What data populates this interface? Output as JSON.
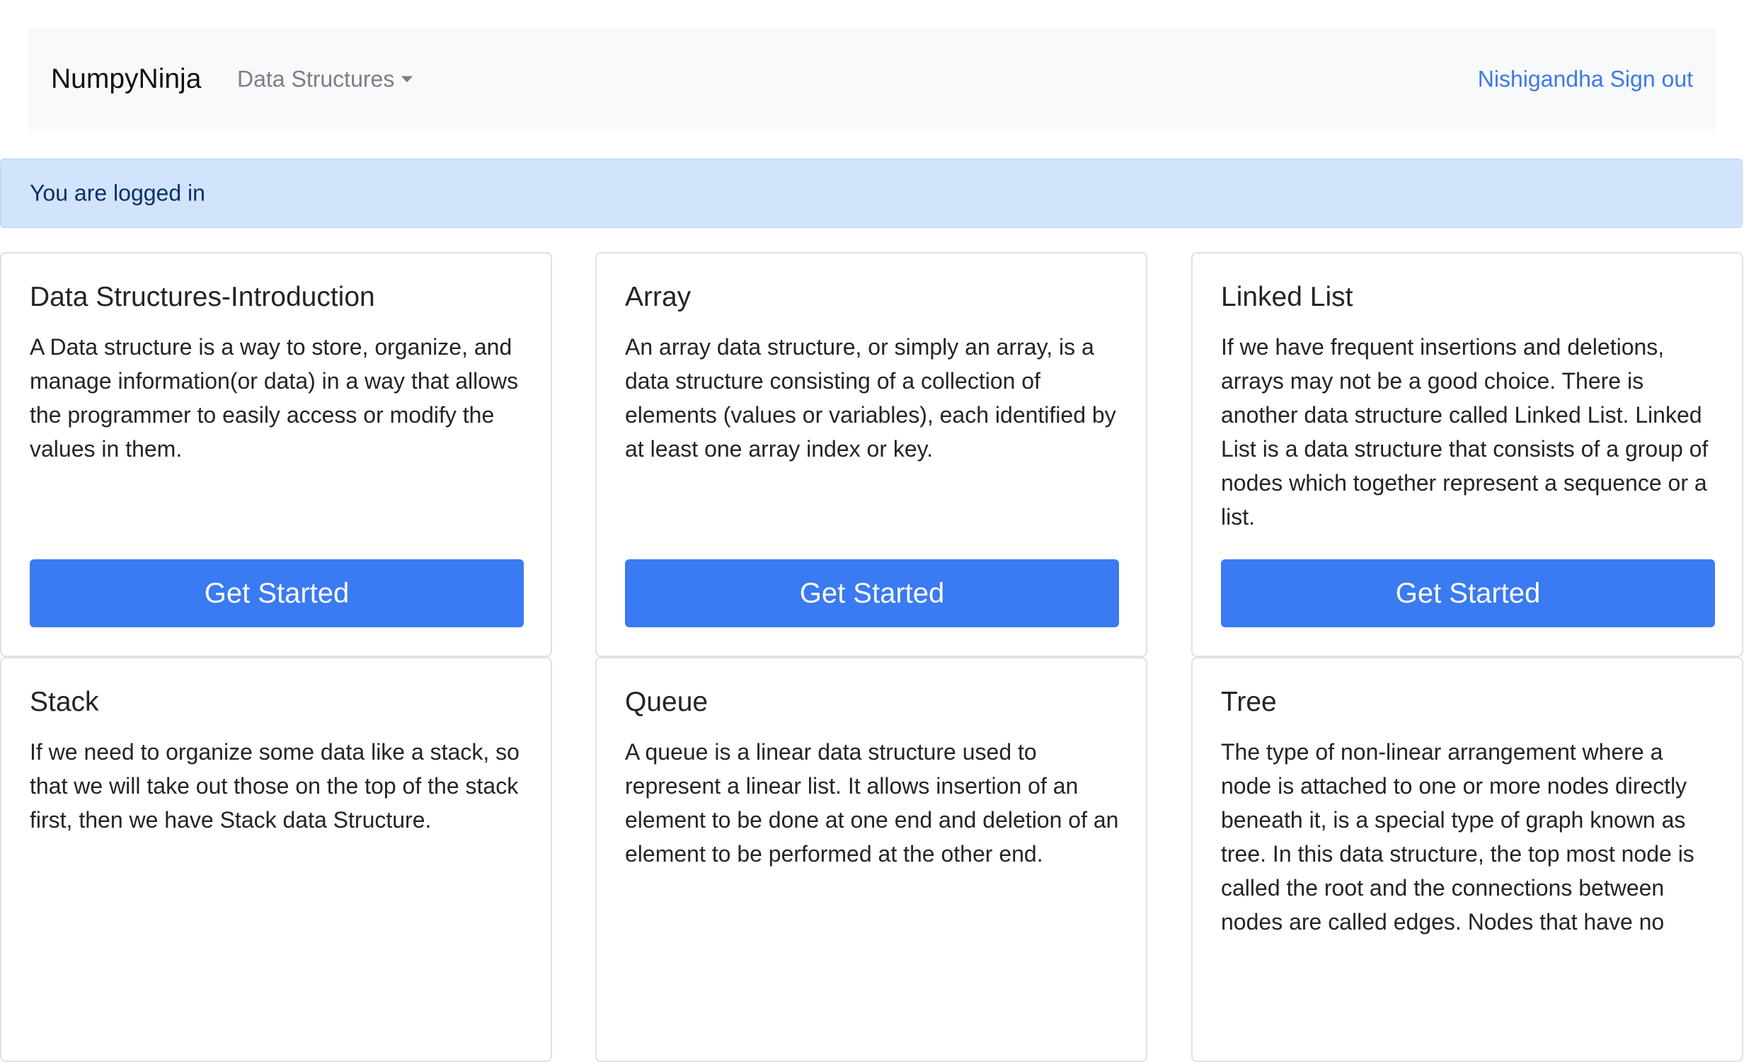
{
  "navbar": {
    "brand": "NumpyNinja",
    "dropdown_label": "Data Structures",
    "user_name": "Nishigandha",
    "sign_out_label": "Sign out"
  },
  "alert": {
    "message": "You are logged in"
  },
  "cards": [
    {
      "title": "Data Structures-Introduction",
      "text": "A Data structure is a way to store, organize, and manage information(or data) in a way that allows the programmer to easily access or modify the values in them.",
      "button_label": "Get Started"
    },
    {
      "title": "Array",
      "text": "An array data structure, or simply an array, is a data structure consisting of a collection of elements (values or variables), each identified by at least one array index or key.",
      "button_label": "Get Started"
    },
    {
      "title": "Linked List",
      "text": "If we have frequent insertions and deletions, arrays may not be a good choice. There is another data structure called Linked List. Linked List is a data structure that consists of a group of nodes which together represent a sequence or a list.",
      "button_label": "Get Started"
    },
    {
      "title": "Stack",
      "text": "If we need to organize some data like a stack, so that we will take out those on the top of the stack first, then we have Stack data Structure."
    },
    {
      "title": "Queue",
      "text": "A queue is a linear data structure used to represent a linear list. It allows insertion of an element to be done at one end and deletion of an element to be performed at the other end."
    },
    {
      "title": "Tree",
      "text": "The type of non-linear arrangement where a node is attached to one or more nodes directly beneath it, is a special type of graph known as tree. In this data structure, the top most node is called the root and the connections between nodes are called edges. Nodes that have no"
    }
  ]
}
